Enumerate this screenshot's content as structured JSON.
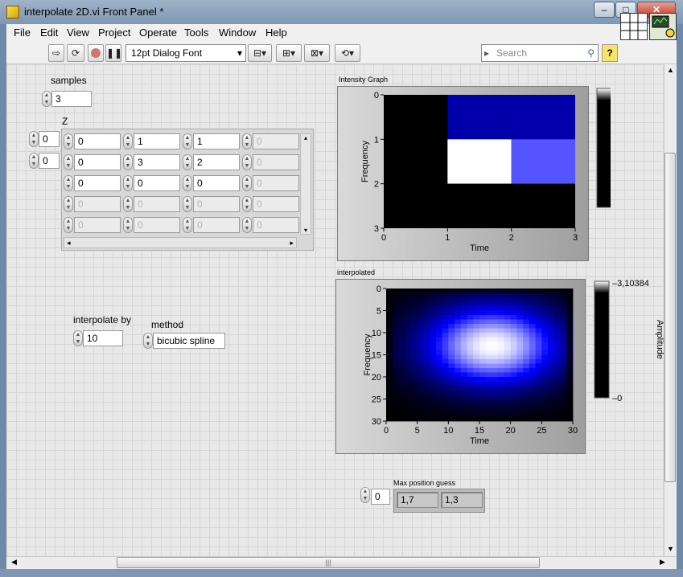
{
  "window": {
    "title": "interpolate 2D.vi Front Panel *",
    "minimize_glyph": "–",
    "maximize_glyph": "□",
    "close_glyph": "✕"
  },
  "menu": [
    "File",
    "Edit",
    "View",
    "Project",
    "Operate",
    "Tools",
    "Window",
    "Help"
  ],
  "toolbar": {
    "font": "12pt Dialog Font",
    "search_placeholder": "Search",
    "help_label": "?"
  },
  "controls": {
    "samples": {
      "label": "samples",
      "value": "3"
    },
    "z": {
      "label": "Z",
      "row_index": "0",
      "col_index": "0",
      "cells": [
        [
          "0",
          "1",
          "1",
          "0"
        ],
        [
          "0",
          "3",
          "2",
          "0"
        ],
        [
          "0",
          "0",
          "0",
          "0"
        ],
        [
          "0",
          "0",
          "0",
          "0"
        ],
        [
          "0",
          "0",
          "0",
          "0"
        ]
      ]
    },
    "interpolate_by": {
      "label": "interpolate by",
      "value": "10"
    },
    "method": {
      "label": "method",
      "value": "bicubic spline"
    },
    "max_index": {
      "value": "0"
    },
    "max_position": {
      "label": "Max position guess",
      "values": [
        "1,7",
        "1,3"
      ]
    }
  },
  "chart_data": [
    {
      "type": "heatmap",
      "title": "Intensity Graph",
      "xlabel": "Time",
      "ylabel": "Frequency",
      "colorbar_label": "Amplitude",
      "x_ticks": [
        "0",
        "1",
        "2",
        "3"
      ],
      "y_ticks": [
        "0",
        "1",
        "2",
        "3"
      ],
      "xlim": [
        0,
        3
      ],
      "ylim": [
        0,
        3
      ],
      "colorbar_ticks": [
        "3",
        "0"
      ],
      "cells": [
        {
          "x": 0,
          "y": 0,
          "value": 0
        },
        {
          "x": 1,
          "y": 0,
          "value": 1
        },
        {
          "x": 2,
          "y": 0,
          "value": 1
        },
        {
          "x": 0,
          "y": 1,
          "value": 0
        },
        {
          "x": 1,
          "y": 1,
          "value": 3
        },
        {
          "x": 2,
          "y": 1,
          "value": 2
        },
        {
          "x": 0,
          "y": 2,
          "value": 0
        },
        {
          "x": 1,
          "y": 2,
          "value": 0
        },
        {
          "x": 2,
          "y": 2,
          "value": 0
        }
      ],
      "z_range": [
        0,
        3
      ],
      "colors": {
        "low": "#000000",
        "mid": "#0000ff",
        "high": "#ffffff"
      }
    },
    {
      "type": "heatmap",
      "title": "interpolated",
      "xlabel": "Time",
      "ylabel": "Frequency",
      "colorbar_label": "Amplitude",
      "x_ticks": [
        "0",
        "5",
        "10",
        "15",
        "20",
        "25",
        "30"
      ],
      "y_ticks": [
        "0",
        "5",
        "10",
        "15",
        "20",
        "25",
        "30"
      ],
      "xlim": [
        0,
        30
      ],
      "ylim": [
        0,
        30
      ],
      "colorbar_ticks": [
        "3,10384",
        "0"
      ],
      "z_range": [
        0,
        3.10384
      ],
      "peak": {
        "x": 17,
        "y": 13
      },
      "colors": {
        "low": "#000000",
        "mid": "#0000ff",
        "high": "#ffffff"
      }
    }
  ]
}
